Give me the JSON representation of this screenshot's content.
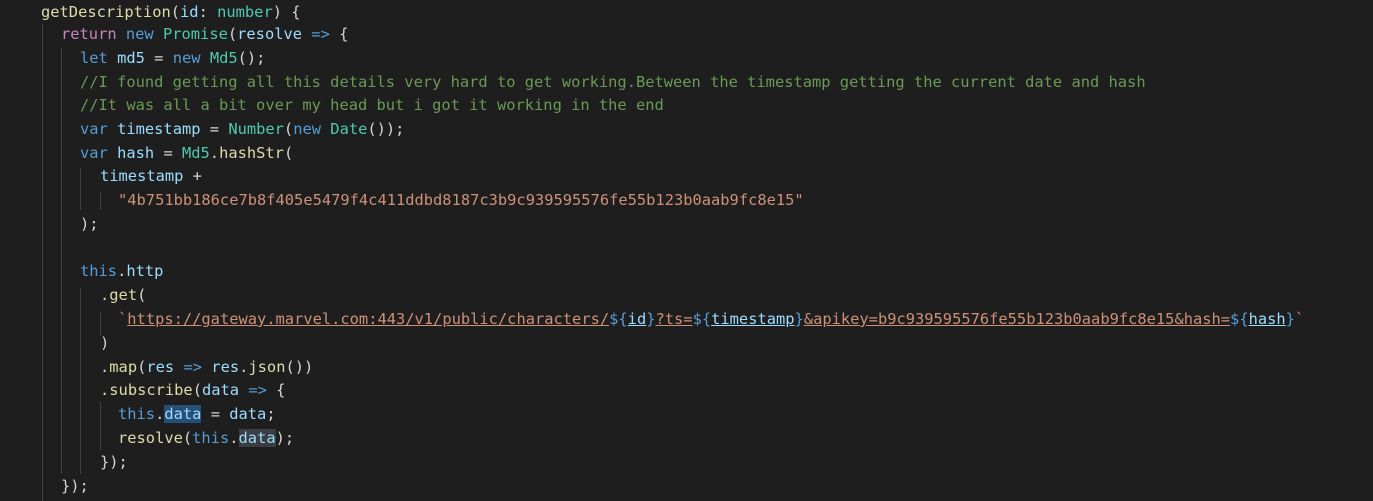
{
  "editor": {
    "lines": [
      {
        "tokens": [
          [
            "fn",
            "getDescription"
          ],
          [
            "op",
            "("
          ],
          [
            "var",
            "id"
          ],
          [
            "op",
            ": "
          ],
          [
            "type",
            "number"
          ],
          [
            "op",
            ") {"
          ]
        ]
      },
      {
        "tokens": [
          [
            "ctl",
            "return"
          ],
          [
            "op",
            " "
          ],
          [
            "kw",
            "new"
          ],
          [
            "op",
            " "
          ],
          [
            "type",
            "Promise"
          ],
          [
            "op",
            "("
          ],
          [
            "var",
            "resolve"
          ],
          [
            "op",
            " "
          ],
          [
            "kw",
            "=>"
          ],
          [
            "op",
            " {"
          ]
        ]
      },
      {
        "tokens": [
          [
            "kw",
            "let"
          ],
          [
            "op",
            " "
          ],
          [
            "var",
            "md5"
          ],
          [
            "op",
            " = "
          ],
          [
            "kw",
            "new"
          ],
          [
            "op",
            " "
          ],
          [
            "type",
            "Md5"
          ],
          [
            "op",
            "();"
          ]
        ]
      },
      {
        "tokens": [
          [
            "cmt",
            "//I found getting all this details very hard to get working.Between the timestamp getting the current date and hash"
          ]
        ]
      },
      {
        "tokens": [
          [
            "cmt",
            "//It was all a bit over my head but i got it working in the end"
          ]
        ]
      },
      {
        "tokens": [
          [
            "kw",
            "var"
          ],
          [
            "op",
            " "
          ],
          [
            "var",
            "timestamp"
          ],
          [
            "op",
            " = "
          ],
          [
            "type",
            "Number"
          ],
          [
            "op",
            "("
          ],
          [
            "kw",
            "new"
          ],
          [
            "op",
            " "
          ],
          [
            "type",
            "Date"
          ],
          [
            "op",
            "());"
          ]
        ]
      },
      {
        "tokens": [
          [
            "kw",
            "var"
          ],
          [
            "op",
            " "
          ],
          [
            "var",
            "hash"
          ],
          [
            "op",
            " = "
          ],
          [
            "type",
            "Md5"
          ],
          [
            "op",
            "."
          ],
          [
            "fn",
            "hashStr"
          ],
          [
            "op",
            "("
          ]
        ]
      },
      {
        "tokens": [
          [
            "var",
            "timestamp"
          ],
          [
            "op",
            " +"
          ]
        ]
      },
      {
        "tokens": [
          [
            "str",
            "\"4b751bb186ce7b8f405e5479f4c411ddbd8187c3b9c939595576fe55b123b0aab9fc8e15\""
          ]
        ]
      },
      {
        "tokens": [
          [
            "op",
            ");"
          ]
        ]
      },
      {
        "tokens": []
      },
      {
        "tokens": [
          [
            "kw",
            "this"
          ],
          [
            "op",
            "."
          ],
          [
            "var",
            "http"
          ]
        ]
      },
      {
        "tokens": [
          [
            "op",
            "."
          ],
          [
            "fn",
            "get"
          ],
          [
            "op",
            "("
          ]
        ]
      },
      {
        "tokens": [
          [
            "str",
            "`"
          ],
          [
            "url",
            "https://gateway.marvel.com:443/v1/public/characters/"
          ],
          [
            "tmpl",
            "${"
          ],
          [
            "varu",
            "id"
          ],
          [
            "tmpl",
            "}"
          ],
          [
            "url",
            "?ts="
          ],
          [
            "tmpl",
            "${"
          ],
          [
            "varu",
            "timestamp"
          ],
          [
            "tmpl",
            "}"
          ],
          [
            "url",
            "&apikey=b9c939595576fe55b123b0aab9fc8e15&hash="
          ],
          [
            "tmpl",
            "${"
          ],
          [
            "varu",
            "hash"
          ],
          [
            "tmpl",
            "}"
          ],
          [
            "str",
            "`"
          ]
        ]
      },
      {
        "tokens": [
          [
            "op",
            ")"
          ]
        ]
      },
      {
        "tokens": [
          [
            "op",
            "."
          ],
          [
            "fn",
            "map"
          ],
          [
            "op",
            "("
          ],
          [
            "var",
            "res"
          ],
          [
            "op",
            " "
          ],
          [
            "kw",
            "=>"
          ],
          [
            "op",
            " "
          ],
          [
            "var",
            "res"
          ],
          [
            "op",
            "."
          ],
          [
            "fn",
            "json"
          ],
          [
            "op",
            "())"
          ]
        ]
      },
      {
        "tokens": [
          [
            "op",
            "."
          ],
          [
            "fn",
            "subscribe"
          ],
          [
            "op",
            "("
          ],
          [
            "var",
            "data"
          ],
          [
            "op",
            " "
          ],
          [
            "kw",
            "=>"
          ],
          [
            "op",
            " {"
          ]
        ]
      },
      {
        "tokens": [
          [
            "kw",
            "this"
          ],
          [
            "op",
            "."
          ],
          [
            "varsel",
            "data"
          ],
          [
            "op",
            " = "
          ],
          [
            "var",
            "data"
          ],
          [
            "op",
            ";"
          ]
        ]
      },
      {
        "tokens": [
          [
            "fn",
            "resolve"
          ],
          [
            "op",
            "("
          ],
          [
            "kw",
            "this"
          ],
          [
            "op",
            "."
          ],
          [
            "varword",
            "data"
          ],
          [
            "op",
            ");"
          ]
        ]
      },
      {
        "tokens": [
          [
            "op",
            "});"
          ]
        ]
      },
      {
        "tokens": [
          [
            "op",
            "});"
          ]
        ]
      }
    ]
  }
}
